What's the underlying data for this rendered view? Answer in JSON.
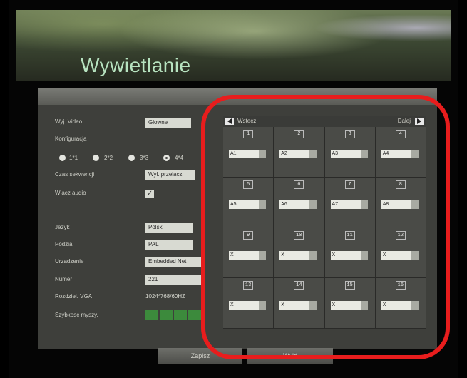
{
  "title": "Wywietlanie",
  "left_panel": {
    "video_out": {
      "label": "Wyj. Video",
      "value": "Glowne"
    },
    "config_label": "Konfiguracja",
    "layouts": [
      {
        "label": "1*1",
        "selected": false
      },
      {
        "label": "2*2",
        "selected": false
      },
      {
        "label": "3*3",
        "selected": false
      },
      {
        "label": "4*4",
        "selected": true
      }
    ],
    "sequence": {
      "label": "Czas sekwencji",
      "value": "Wyl. przelacz"
    },
    "audio": {
      "label": "Wlacz audio",
      "checked": true
    },
    "language": {
      "label": "Jezyk",
      "value": "Polski"
    },
    "standard": {
      "label": "Podzial",
      "value": "PAL"
    },
    "device": {
      "label": "Urzadzenie",
      "value": "Embedded Net"
    },
    "number": {
      "label": "Numer",
      "value": "221"
    },
    "vga": {
      "label": "Rozdziel. VGA",
      "value": "1024*768/60HZ"
    },
    "mouse": {
      "label": "Szybkosc myszy.",
      "level_segments": 4
    }
  },
  "grid": {
    "prev_label": "Wstecz",
    "next_label": "Dalej",
    "cells": [
      {
        "num": "1",
        "value": "A1"
      },
      {
        "num": "2",
        "value": "A2"
      },
      {
        "num": "3",
        "value": "A3"
      },
      {
        "num": "4",
        "value": "A4"
      },
      {
        "num": "5",
        "value": "A5"
      },
      {
        "num": "6",
        "value": "A6"
      },
      {
        "num": "7",
        "value": "A7"
      },
      {
        "num": "8",
        "value": "A8"
      },
      {
        "num": "9",
        "value": "X"
      },
      {
        "num": "10",
        "value": "X"
      },
      {
        "num": "11",
        "value": "X"
      },
      {
        "num": "12",
        "value": "X"
      },
      {
        "num": "13",
        "value": "X"
      },
      {
        "num": "14",
        "value": "X"
      },
      {
        "num": "15",
        "value": "X"
      },
      {
        "num": "16",
        "value": "X"
      }
    ]
  },
  "buttons": {
    "save": "Zapisz",
    "exit": "Wyjd"
  },
  "colors": {
    "highlight": "#e81d1d",
    "mouse_bar": "#3c8a3c",
    "title": "#b7e3c0"
  }
}
